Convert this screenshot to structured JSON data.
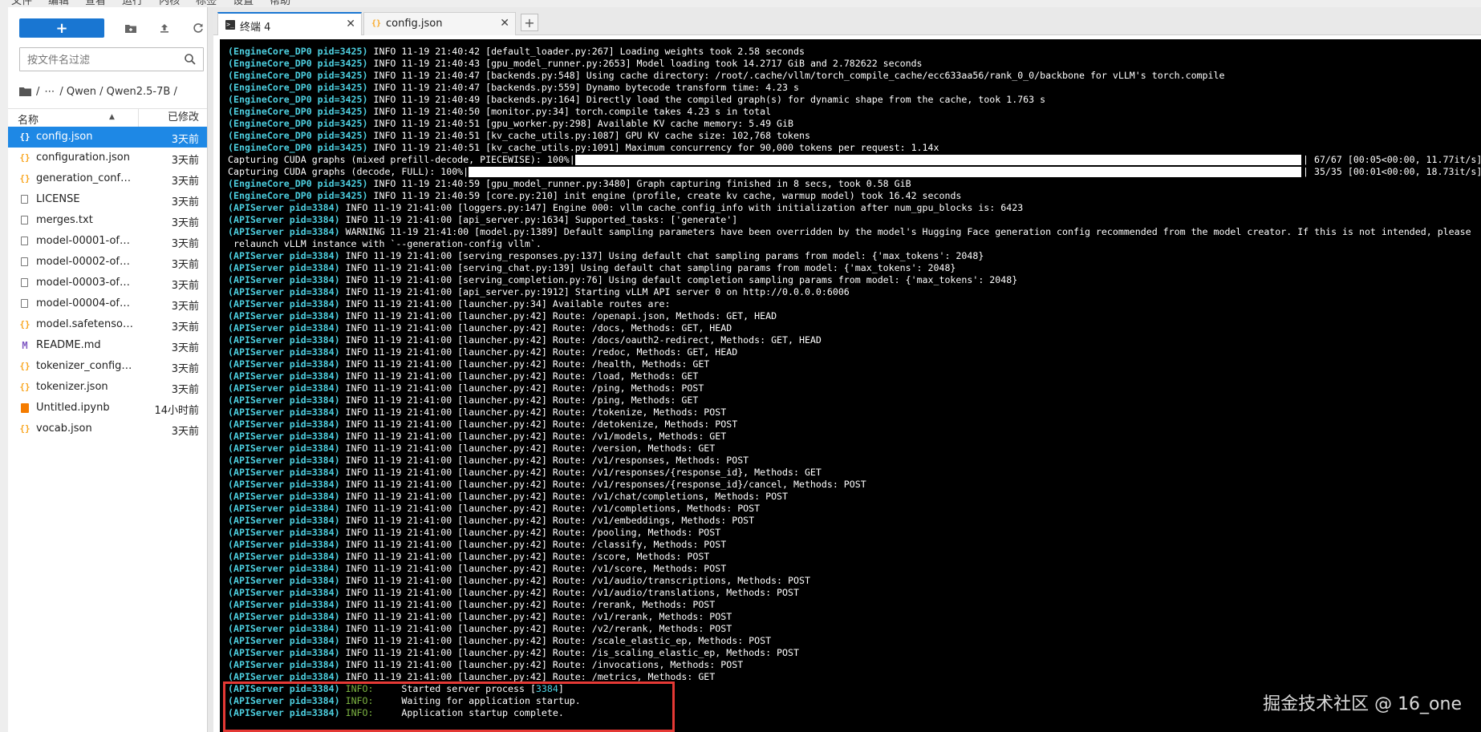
{
  "menubar": {
    "items": [
      "文件",
      "编辑",
      "查看",
      "运行",
      "内核",
      "标签",
      "设置",
      "帮助"
    ]
  },
  "file_browser": {
    "new_button_label": "+",
    "search_placeholder": "按文件名过滤",
    "breadcrumb": [
      "/",
      "⋯",
      "/ Qwen / Qwen2.5-7B /"
    ],
    "header": {
      "name": "名称",
      "modified": "已修改"
    },
    "files": [
      {
        "name": "config.json",
        "modified": "3天前",
        "icon": "json-icon",
        "selected": true
      },
      {
        "name": "configuration.json",
        "modified": "3天前",
        "icon": "json-icon"
      },
      {
        "name": "generation_conf…",
        "modified": "3天前",
        "icon": "json-icon"
      },
      {
        "name": "LICENSE",
        "modified": "3天前",
        "icon": "file-icon"
      },
      {
        "name": "merges.txt",
        "modified": "3天前",
        "icon": "file-icon"
      },
      {
        "name": "model-00001-of…",
        "modified": "3天前",
        "icon": "file-icon"
      },
      {
        "name": "model-00002-of…",
        "modified": "3天前",
        "icon": "file-icon"
      },
      {
        "name": "model-00003-of…",
        "modified": "3天前",
        "icon": "file-icon"
      },
      {
        "name": "model-00004-of…",
        "modified": "3天前",
        "icon": "file-icon"
      },
      {
        "name": "model.safetenso…",
        "modified": "3天前",
        "icon": "json-icon"
      },
      {
        "name": "README.md",
        "modified": "3天前",
        "icon": "markdown-icon"
      },
      {
        "name": "tokenizer_config…",
        "modified": "3天前",
        "icon": "json-icon"
      },
      {
        "name": "tokenizer.json",
        "modified": "3天前",
        "icon": "json-icon"
      },
      {
        "name": "Untitled.ipynb",
        "modified": "14小时前",
        "icon": "notebook-icon"
      },
      {
        "name": "vocab.json",
        "modified": "3天前",
        "icon": "json-icon"
      }
    ]
  },
  "tabs": [
    {
      "label": "终端 4",
      "icon": "terminal-icon",
      "active": true
    },
    {
      "label": "config.json",
      "icon": "json-icon",
      "active": false
    }
  ],
  "terminal": {
    "lines": [
      {
        "prefix": "(EngineCore_DP0 pid=3425)",
        "text": " INFO 11-19 21:40:42 [default_loader.py:267] Loading weights took 2.58 seconds"
      },
      {
        "prefix": "(EngineCore_DP0 pid=3425)",
        "text": " INFO 11-19 21:40:43 [gpu_model_runner.py:2653] Model loading took 14.2717 GiB and 2.782622 seconds"
      },
      {
        "prefix": "(EngineCore_DP0 pid=3425)",
        "text": " INFO 11-19 21:40:47 [backends.py:548] Using cache directory: /root/.cache/vllm/torch_compile_cache/ecc633aa56/rank_0_0/backbone for vLLM's torch.compile"
      },
      {
        "prefix": "(EngineCore_DP0 pid=3425)",
        "text": " INFO 11-19 21:40:47 [backends.py:559] Dynamo bytecode transform time: 4.23 s"
      },
      {
        "prefix": "(EngineCore_DP0 pid=3425)",
        "text": " INFO 11-19 21:40:49 [backends.py:164] Directly load the compiled graph(s) for dynamic shape from the cache, took 1.763 s"
      },
      {
        "prefix": "(EngineCore_DP0 pid=3425)",
        "text": " INFO 11-19 21:40:50 [monitor.py:34] torch.compile takes 4.23 s in total"
      },
      {
        "prefix": "(EngineCore_DP0 pid=3425)",
        "text": " INFO 11-19 21:40:51 [gpu_worker.py:298] Available KV cache memory: 5.49 GiB"
      },
      {
        "prefix": "(EngineCore_DP0 pid=3425)",
        "text": " INFO 11-19 21:40:51 [kv_cache_utils.py:1087] GPU KV cache size: 102,768 tokens"
      },
      {
        "prefix": "(EngineCore_DP0 pid=3425)",
        "text": " INFO 11-19 21:40:51 [kv_cache_utils.py:1091] Maximum concurrency for 90,000 tokens per request: 1.14x"
      },
      {
        "prefix": "",
        "text": "Capturing CUDA graphs (mixed prefill-decode, PIECEWISE): 100%|",
        "progress": 1.0,
        "stat": "| 67/67 [00:05<00:00, 11.77it/s]"
      },
      {
        "prefix": "",
        "text": "Capturing CUDA graphs (decode, FULL): 100%|",
        "progress": 1.0,
        "stat": "| 35/35 [00:01<00:00, 18.73it/s]"
      },
      {
        "prefix": "(EngineCore_DP0 pid=3425)",
        "text": " INFO 11-19 21:40:59 [gpu_model_runner.py:3480] Graph capturing finished in 8 secs, took 0.58 GiB"
      },
      {
        "prefix": "(EngineCore_DP0 pid=3425)",
        "text": " INFO 11-19 21:40:59 [core.py:210] init engine (profile, create kv cache, warmup model) took 16.42 seconds"
      },
      {
        "prefix": "(APIServer pid=3384)",
        "text": " INFO 11-19 21:41:00 [loggers.py:147] Engine 000: vllm cache_config_info with initialization after num_gpu_blocks is: 6423"
      },
      {
        "prefix": "(APIServer pid=3384)",
        "text": " INFO 11-19 21:41:00 [api_server.py:1634] Supported_tasks: ['generate']"
      },
      {
        "prefix": "(APIServer pid=3384)",
        "text": " WARNING 11-19 21:41:00 [model.py:1389] Default sampling parameters have been overridden by the model's Hugging Face generation config recommended from the model creator. If this is not intended, please"
      },
      {
        "prefix": "",
        "text": " relaunch vLLM instance with `--generation-config vllm`."
      },
      {
        "prefix": "(APIServer pid=3384)",
        "text": " INFO 11-19 21:41:00 [serving_responses.py:137] Using default chat sampling params from model: {'max_tokens': 2048}"
      },
      {
        "prefix": "(APIServer pid=3384)",
        "text": " INFO 11-19 21:41:00 [serving_chat.py:139] Using default chat sampling params from model: {'max_tokens': 2048}"
      },
      {
        "prefix": "(APIServer pid=3384)",
        "text": " INFO 11-19 21:41:00 [serving_completion.py:76] Using default completion sampling params from model: {'max_tokens': 2048}"
      },
      {
        "prefix": "(APIServer pid=3384)",
        "text": " INFO 11-19 21:41:00 [api_server.py:1912] Starting vLLM API server 0 on http://0.0.0.0:6006"
      },
      {
        "prefix": "(APIServer pid=3384)",
        "text": " INFO 11-19 21:41:00 [launcher.py:34] Available routes are:"
      },
      {
        "prefix": "(APIServer pid=3384)",
        "text": " INFO 11-19 21:41:00 [launcher.py:42] Route: /openapi.json, Methods: GET, HEAD"
      },
      {
        "prefix": "(APIServer pid=3384)",
        "text": " INFO 11-19 21:41:00 [launcher.py:42] Route: /docs, Methods: GET, HEAD"
      },
      {
        "prefix": "(APIServer pid=3384)",
        "text": " INFO 11-19 21:41:00 [launcher.py:42] Route: /docs/oauth2-redirect, Methods: GET, HEAD"
      },
      {
        "prefix": "(APIServer pid=3384)",
        "text": " INFO 11-19 21:41:00 [launcher.py:42] Route: /redoc, Methods: GET, HEAD"
      },
      {
        "prefix": "(APIServer pid=3384)",
        "text": " INFO 11-19 21:41:00 [launcher.py:42] Route: /health, Methods: GET"
      },
      {
        "prefix": "(APIServer pid=3384)",
        "text": " INFO 11-19 21:41:00 [launcher.py:42] Route: /load, Methods: GET"
      },
      {
        "prefix": "(APIServer pid=3384)",
        "text": " INFO 11-19 21:41:00 [launcher.py:42] Route: /ping, Methods: POST"
      },
      {
        "prefix": "(APIServer pid=3384)",
        "text": " INFO 11-19 21:41:00 [launcher.py:42] Route: /ping, Methods: GET"
      },
      {
        "prefix": "(APIServer pid=3384)",
        "text": " INFO 11-19 21:41:00 [launcher.py:42] Route: /tokenize, Methods: POST"
      },
      {
        "prefix": "(APIServer pid=3384)",
        "text": " INFO 11-19 21:41:00 [launcher.py:42] Route: /detokenize, Methods: POST"
      },
      {
        "prefix": "(APIServer pid=3384)",
        "text": " INFO 11-19 21:41:00 [launcher.py:42] Route: /v1/models, Methods: GET"
      },
      {
        "prefix": "(APIServer pid=3384)",
        "text": " INFO 11-19 21:41:00 [launcher.py:42] Route: /version, Methods: GET"
      },
      {
        "prefix": "(APIServer pid=3384)",
        "text": " INFO 11-19 21:41:00 [launcher.py:42] Route: /v1/responses, Methods: POST"
      },
      {
        "prefix": "(APIServer pid=3384)",
        "text": " INFO 11-19 21:41:00 [launcher.py:42] Route: /v1/responses/{response_id}, Methods: GET"
      },
      {
        "prefix": "(APIServer pid=3384)",
        "text": " INFO 11-19 21:41:00 [launcher.py:42] Route: /v1/responses/{response_id}/cancel, Methods: POST"
      },
      {
        "prefix": "(APIServer pid=3384)",
        "text": " INFO 11-19 21:41:00 [launcher.py:42] Route: /v1/chat/completions, Methods: POST"
      },
      {
        "prefix": "(APIServer pid=3384)",
        "text": " INFO 11-19 21:41:00 [launcher.py:42] Route: /v1/completions, Methods: POST"
      },
      {
        "prefix": "(APIServer pid=3384)",
        "text": " INFO 11-19 21:41:00 [launcher.py:42] Route: /v1/embeddings, Methods: POST"
      },
      {
        "prefix": "(APIServer pid=3384)",
        "text": " INFO 11-19 21:41:00 [launcher.py:42] Route: /pooling, Methods: POST"
      },
      {
        "prefix": "(APIServer pid=3384)",
        "text": " INFO 11-19 21:41:00 [launcher.py:42] Route: /classify, Methods: POST"
      },
      {
        "prefix": "(APIServer pid=3384)",
        "text": " INFO 11-19 21:41:00 [launcher.py:42] Route: /score, Methods: POST"
      },
      {
        "prefix": "(APIServer pid=3384)",
        "text": " INFO 11-19 21:41:00 [launcher.py:42] Route: /v1/score, Methods: POST"
      },
      {
        "prefix": "(APIServer pid=3384)",
        "text": " INFO 11-19 21:41:00 [launcher.py:42] Route: /v1/audio/transcriptions, Methods: POST"
      },
      {
        "prefix": "(APIServer pid=3384)",
        "text": " INFO 11-19 21:41:00 [launcher.py:42] Route: /v1/audio/translations, Methods: POST"
      },
      {
        "prefix": "(APIServer pid=3384)",
        "text": " INFO 11-19 21:41:00 [launcher.py:42] Route: /rerank, Methods: POST"
      },
      {
        "prefix": "(APIServer pid=3384)",
        "text": " INFO 11-19 21:41:00 [launcher.py:42] Route: /v1/rerank, Methods: POST"
      },
      {
        "prefix": "(APIServer pid=3384)",
        "text": " INFO 11-19 21:41:00 [launcher.py:42] Route: /v2/rerank, Methods: POST"
      },
      {
        "prefix": "(APIServer pid=3384)",
        "text": " INFO 11-19 21:41:00 [launcher.py:42] Route: /scale_elastic_ep, Methods: POST"
      },
      {
        "prefix": "(APIServer pid=3384)",
        "text": " INFO 11-19 21:41:00 [launcher.py:42] Route: /is_scaling_elastic_ep, Methods: POST"
      },
      {
        "prefix": "(APIServer pid=3384)",
        "text": " INFO 11-19 21:41:00 [launcher.py:42] Route: /invocations, Methods: POST"
      },
      {
        "prefix": "(APIServer pid=3384)",
        "text": " INFO 11-19 21:41:00 [launcher.py:42] Route: /metrics, Methods: GET"
      },
      {
        "prefix": "(APIServer pid=3384)",
        "level": " INFO:",
        "text": "     Started server process [",
        "pid": "3384",
        "tail": "]"
      },
      {
        "prefix": "(APIServer pid=3384)",
        "level": " INFO:",
        "text": "     Waiting for application startup."
      },
      {
        "prefix": "(APIServer pid=3384)",
        "level": " INFO:",
        "text": "     Application startup complete."
      }
    ]
  },
  "watermark": "掘金技术社区 @ 16_one"
}
